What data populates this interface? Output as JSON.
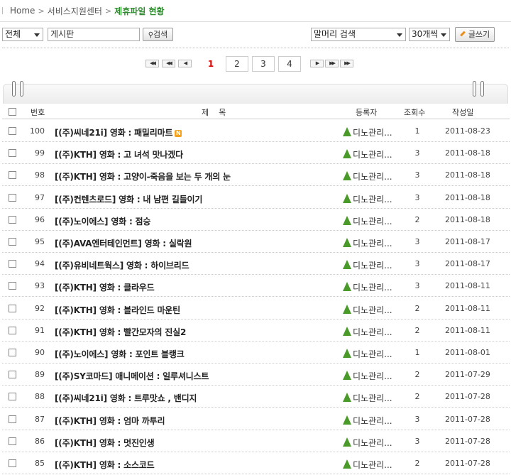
{
  "breadcrumb": {
    "home": "Home",
    "level1": "서비스지원센터",
    "current": "제휴파일 현황"
  },
  "toolbar": {
    "category_select": "전체",
    "board_input": "게시판",
    "search_button": "검색",
    "field_select": "말머리 검색",
    "perpage_select": "30개씩",
    "write_button": "글쓰기"
  },
  "pagination": {
    "pages": [
      "1",
      "2",
      "3",
      "4"
    ],
    "current": "1"
  },
  "table": {
    "headers": {
      "no": "번호",
      "title": "제    목",
      "author": "등록자",
      "views": "조회수",
      "date": "작성일"
    },
    "rows": [
      {
        "no": "100",
        "title": "[(주)씨네21i] 영화 : 패밀리마트",
        "author": "디노관리...",
        "views": "1",
        "date": "2011-08-23",
        "new": "N"
      },
      {
        "no": "99",
        "title": "[(주)KTH] 영화 : 고 녀석 맛나겠다",
        "author": "디노관리...",
        "views": "3",
        "date": "2011-08-18"
      },
      {
        "no": "98",
        "title": "[(주)KTH] 영화 : 고양이-죽음을 보는 두 개의 눈",
        "author": "디노관리...",
        "views": "3",
        "date": "2011-08-18"
      },
      {
        "no": "97",
        "title": "[(주)컨텐츠로드] 영화 : 내 남편 길들이기",
        "author": "디노관리...",
        "views": "3",
        "date": "2011-08-18"
      },
      {
        "no": "96",
        "title": "[(주)노이에스] 영화 : 점승",
        "author": "디노관리...",
        "views": "2",
        "date": "2011-08-18"
      },
      {
        "no": "95",
        "title": "[(주)AVA엔터테인먼트] 영화 : 실락원",
        "author": "디노관리...",
        "views": "3",
        "date": "2011-08-17"
      },
      {
        "no": "94",
        "title": "[(주)유비네트웍스] 영화 : 하이브리드",
        "author": "디노관리...",
        "views": "3",
        "date": "2011-08-17"
      },
      {
        "no": "93",
        "title": "[(주)KTH] 영화 : 클라우드",
        "author": "디노관리...",
        "views": "3",
        "date": "2011-08-11"
      },
      {
        "no": "92",
        "title": "[(주)KTH] 영화 : 블라인드 마운틴",
        "author": "디노관리...",
        "views": "2",
        "date": "2011-08-11"
      },
      {
        "no": "91",
        "title": "[(주)KTH] 영화 : 빨간모자의 진실2",
        "author": "디노관리...",
        "views": "2",
        "date": "2011-08-11"
      },
      {
        "no": "90",
        "title": "[(주)노이에스] 영화 : 포인트 블랭크",
        "author": "디노관리...",
        "views": "1",
        "date": "2011-08-01"
      },
      {
        "no": "89",
        "title": "[(주)SY코마드] 애니메이션 : 일루셔니스트",
        "author": "디노관리...",
        "views": "2",
        "date": "2011-07-29"
      },
      {
        "no": "88",
        "title": "[(주)씨네21i] 영화 : 트루맛쇼 , 밴디지",
        "author": "디노관리...",
        "views": "2",
        "date": "2011-07-28"
      },
      {
        "no": "87",
        "title": "[(주)KTH] 영화 : 엄마 까투리",
        "author": "디노관리...",
        "views": "3",
        "date": "2011-07-28"
      },
      {
        "no": "86",
        "title": "[(주)KTH] 영화 : 멋진인생",
        "author": "디노관리...",
        "views": "3",
        "date": "2011-07-28"
      },
      {
        "no": "85",
        "title": "[(주)KTH] 영화 : 소스코드",
        "author": "디노관리...",
        "views": "2",
        "date": "2011-07-28"
      }
    ]
  }
}
